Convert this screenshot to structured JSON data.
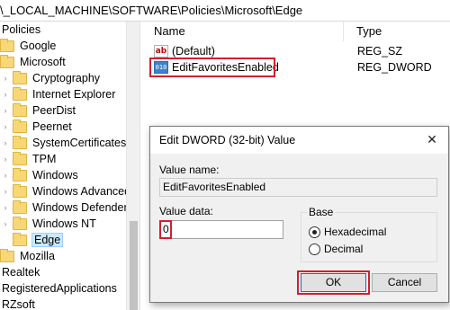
{
  "address_path": "\\_LOCAL_MACHINE\\SOFTWARE\\Policies\\Microsoft\\Edge",
  "tree": {
    "items": [
      {
        "label": "Policies"
      },
      {
        "label": "Google"
      },
      {
        "label": "Microsoft"
      },
      {
        "label": "Cryptography"
      },
      {
        "label": "Internet Explorer"
      },
      {
        "label": "PeerDist"
      },
      {
        "label": "Peernet"
      },
      {
        "label": "SystemCertificates"
      },
      {
        "label": "TPM"
      },
      {
        "label": "Windows"
      },
      {
        "label": "Windows Advanced"
      },
      {
        "label": "Windows Defender"
      },
      {
        "label": "Windows NT"
      },
      {
        "label": "Edge"
      },
      {
        "label": "Mozilla"
      },
      {
        "label": "Realtek"
      },
      {
        "label": "RegisteredApplications"
      },
      {
        "label": "RZsoft"
      }
    ]
  },
  "values": {
    "columns": {
      "name": "Name",
      "type": "Type"
    },
    "rows": [
      {
        "name": "(Default)",
        "type": "REG_SZ",
        "icon": "string-value-icon",
        "glyph": "ab"
      },
      {
        "name": "EditFavoritesEnabled",
        "type": "REG_DWORD",
        "icon": "dword-value-icon",
        "glyph": "010"
      }
    ]
  },
  "dialog": {
    "title": "Edit DWORD (32-bit) Value",
    "close_glyph": "✕",
    "value_name_label": "Value name:",
    "value_name": "EditFavoritesEnabled",
    "value_data_label": "Value data:",
    "value_data": "0",
    "base_label": "Base",
    "base_options": [
      {
        "label": "Hexadecimal",
        "selected": true
      },
      {
        "label": "Decimal",
        "selected": false
      }
    ],
    "ok_label": "OK",
    "cancel_label": "Cancel"
  },
  "colors": {
    "highlight_red": "#d0202e",
    "folder_yellow": "#f8d775",
    "selection_blue": "#cce8ff"
  }
}
